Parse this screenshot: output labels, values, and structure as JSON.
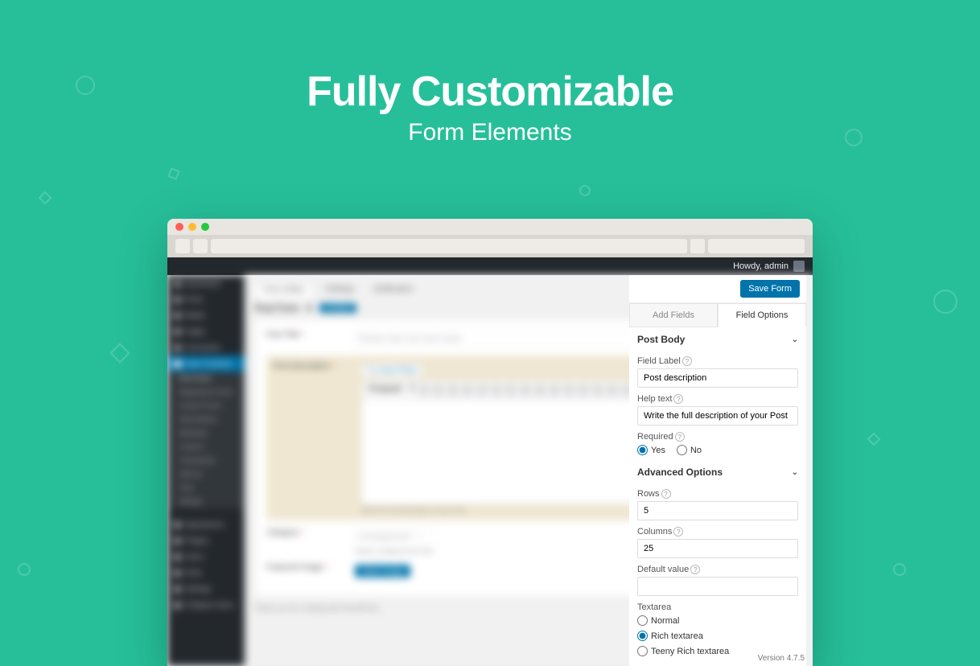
{
  "hero": {
    "title": "Fully Customizable",
    "subtitle": "Form Elements"
  },
  "howdy": "Howdy, admin",
  "saveForm": "Save Form",
  "tabs": {
    "addFields": "Add Fields",
    "fieldOptions": "Field Options"
  },
  "section1": "Post Body",
  "fieldLabel": {
    "label": "Field Label",
    "value": "Post description"
  },
  "helpText": {
    "label": "Help text",
    "value": "Write the full description of your Post"
  },
  "required": {
    "label": "Required",
    "yes": "Yes",
    "no": "No"
  },
  "section2": "Advanced Options",
  "rows": {
    "label": "Rows",
    "value": "5"
  },
  "cols": {
    "label": "Columns",
    "value": "25"
  },
  "defaultval": {
    "label": "Default value",
    "value": ""
  },
  "textarea": {
    "label": "Textarea",
    "opts": {
      "normal": "Normal",
      "rich": "Rich textarea",
      "teeny": "Teeny Rich textarea"
    }
  },
  "version": "Version 4.7.5",
  "blurred": {
    "nav": [
      "Dashboard",
      "Posts",
      "Media",
      "Pages",
      "Comments"
    ],
    "navActive": "User Frontend",
    "sub": [
      "Post Forms",
      "Registration Forms",
      "Content Forms",
      "Subscriptions",
      "Marketing",
      "Coupons",
      "Transactions",
      "Add-ons",
      "Tools",
      "Settings"
    ],
    "nav2": [
      "Appearance",
      "Plugins",
      "Users",
      "Tools",
      "Settings",
      "Collapse menu"
    ],
    "hdrTabs": [
      "Form Editor",
      "Settings",
      "Notification"
    ],
    "formName": "Post Form",
    "tag": "# POST",
    "rows": {
      "title": {
        "l": "Post Title",
        "ph": "Please enter your post name"
      },
      "desc": {
        "l": "Post description",
        "help": "Write the full description of your Post"
      },
      "cat": {
        "l": "Category",
        "val": "Uncategorized",
        "help": "Select a category from here"
      },
      "img": {
        "l": "Featured Image",
        "btn": "Select Image"
      }
    },
    "insertPhoto": "Insert Photo",
    "paragraph": "Paragraph",
    "credit": "Thank you for creating with WordPress."
  }
}
